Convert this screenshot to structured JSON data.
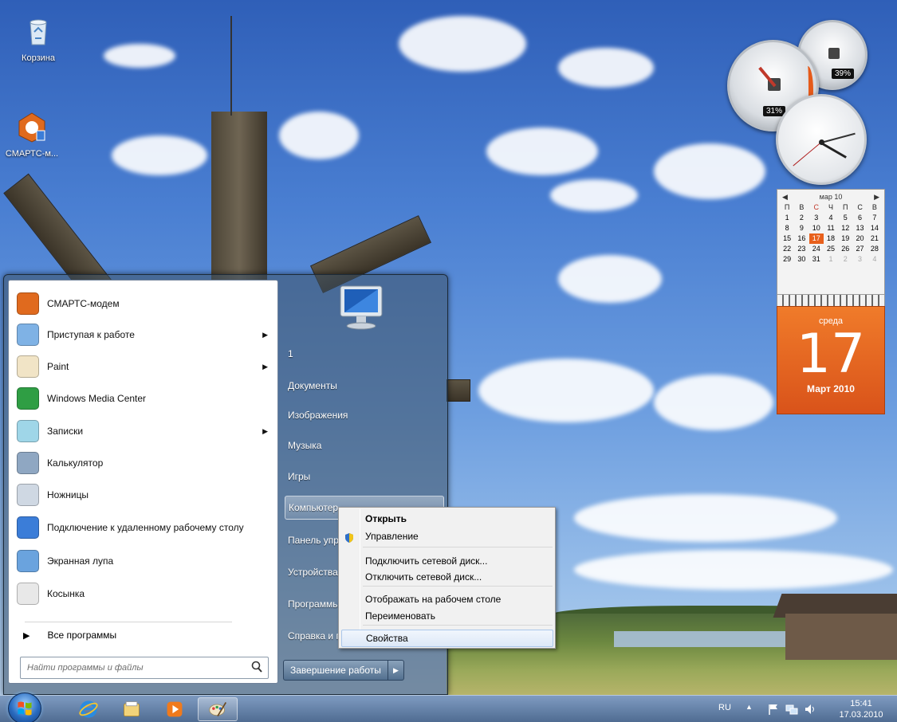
{
  "desktop": {
    "icons": [
      {
        "label": "Корзина"
      },
      {
        "label": "СМАРТС-м..."
      }
    ]
  },
  "gadgets": {
    "cpu_meter": {
      "cpu_percent": "31%",
      "memory_percent": "39%"
    },
    "calendar": {
      "month_label": "мар 10",
      "weekdays": [
        "П",
        "В",
        "С",
        "Ч",
        "П",
        "С",
        "В"
      ],
      "weeks": [
        [
          "",
          "",
          "",
          "",
          "",
          "",
          ""
        ],
        [
          "1",
          "2",
          "3",
          "4",
          "5",
          "6",
          "7"
        ],
        [
          "8",
          "9",
          "10",
          "11",
          "12",
          "13",
          "14"
        ],
        [
          "15",
          "16",
          "17",
          "18",
          "19",
          "20",
          "21"
        ],
        [
          "22",
          "23",
          "24",
          "25",
          "26",
          "27",
          "28"
        ],
        [
          "29",
          "30",
          "31",
          "1",
          "2",
          "3",
          "4"
        ]
      ],
      "today": "17",
      "big_dow": "среда",
      "big_day": "17",
      "big_month_year": "Март 2010"
    }
  },
  "start_menu": {
    "programs": [
      {
        "label": "СМАРТС-модем",
        "submenu": false,
        "icon": "smarts-modem-icon"
      },
      {
        "label": "Приступая к работе",
        "submenu": true,
        "icon": "getting-started-icon"
      },
      {
        "label": "Paint",
        "submenu": true,
        "icon": "paint-icon"
      },
      {
        "label": "Windows Media Center",
        "submenu": false,
        "icon": "media-center-icon"
      },
      {
        "label": "Записки",
        "submenu": true,
        "icon": "sticky-notes-icon"
      },
      {
        "label": "Калькулятор",
        "submenu": false,
        "icon": "calculator-icon"
      },
      {
        "label": "Ножницы",
        "submenu": false,
        "icon": "snipping-tool-icon"
      },
      {
        "label": "Подключение к удаленному рабочему столу",
        "submenu": false,
        "icon": "remote-desktop-icon"
      },
      {
        "label": "Экранная лупа",
        "submenu": false,
        "icon": "magnifier-icon"
      },
      {
        "label": "Косынка",
        "submenu": false,
        "icon": "solitaire-icon"
      }
    ],
    "all_programs": "Все программы",
    "search_placeholder": "Найти программы и файлы",
    "right_items": [
      {
        "label": "1"
      },
      {
        "label": "Документы"
      },
      {
        "label": "Изображения"
      },
      {
        "label": "Музыка"
      },
      {
        "label": "Игры"
      },
      {
        "label": "Компьютер"
      },
      {
        "label": "Панель управления"
      },
      {
        "label": "Устройства и принтеры"
      },
      {
        "label": "Программы по умолчанию"
      },
      {
        "label": "Справка и поддержка"
      }
    ],
    "shutdown_label": "Завершение работы"
  },
  "context_menu": {
    "items": [
      {
        "label": "Открыть",
        "bold": true
      },
      {
        "label": "Управление",
        "bold": false
      },
      {
        "label": "Подключить сетевой диск...",
        "bold": false
      },
      {
        "label": "Отключить сетевой диск...",
        "bold": false
      },
      {
        "label": "Отображать на рабочем столе",
        "bold": false
      },
      {
        "label": "Переименовать",
        "bold": false
      },
      {
        "label": "Свойства",
        "bold": false
      }
    ]
  },
  "taskbar": {
    "language": "RU",
    "time": "15:41",
    "date": "17.03.2010"
  }
}
